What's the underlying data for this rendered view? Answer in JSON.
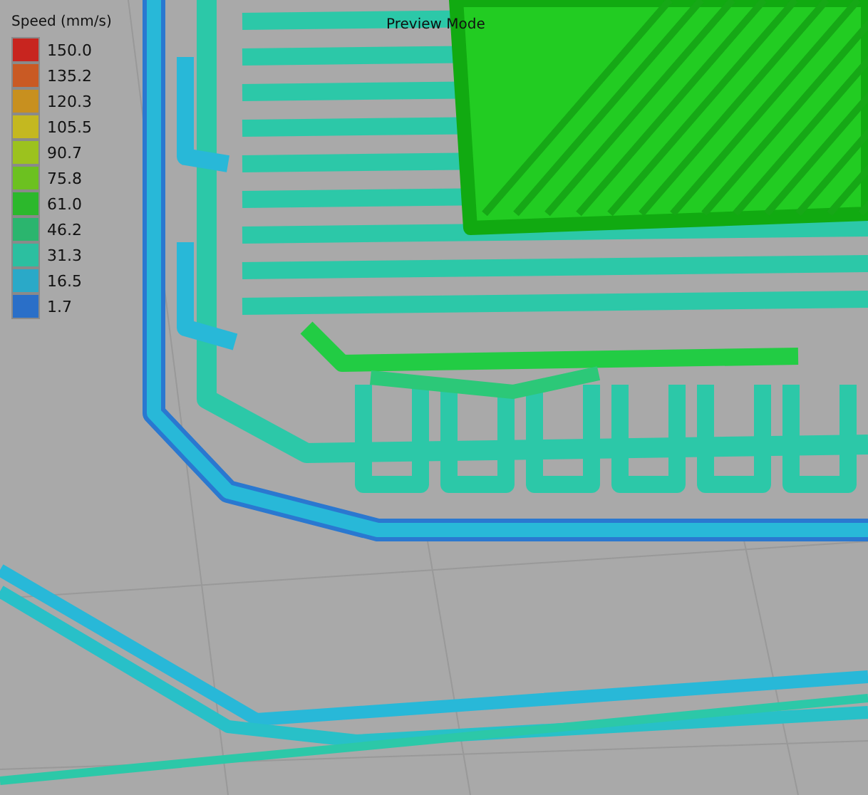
{
  "view": {
    "mode_label": "Preview Mode"
  },
  "legend": {
    "title": "Speed (mm/s)",
    "items": [
      {
        "label": "150.0",
        "color": "#c8251f"
      },
      {
        "label": "135.2",
        "color": "#c95a24"
      },
      {
        "label": "120.3",
        "color": "#c8901f"
      },
      {
        "label": "105.5",
        "color": "#c4b820"
      },
      {
        "label": "90.7",
        "color": "#9cc21e"
      },
      {
        "label": "75.8",
        "color": "#6cc120"
      },
      {
        "label": "61.0",
        "color": "#2cb82c"
      },
      {
        "label": "46.2",
        "color": "#2bb56e"
      },
      {
        "label": "31.3",
        "color": "#2cbfa0"
      },
      {
        "label": "16.5",
        "color": "#2aa9c8"
      },
      {
        "label": "1.7",
        "color": "#2a6fc8"
      }
    ]
  }
}
